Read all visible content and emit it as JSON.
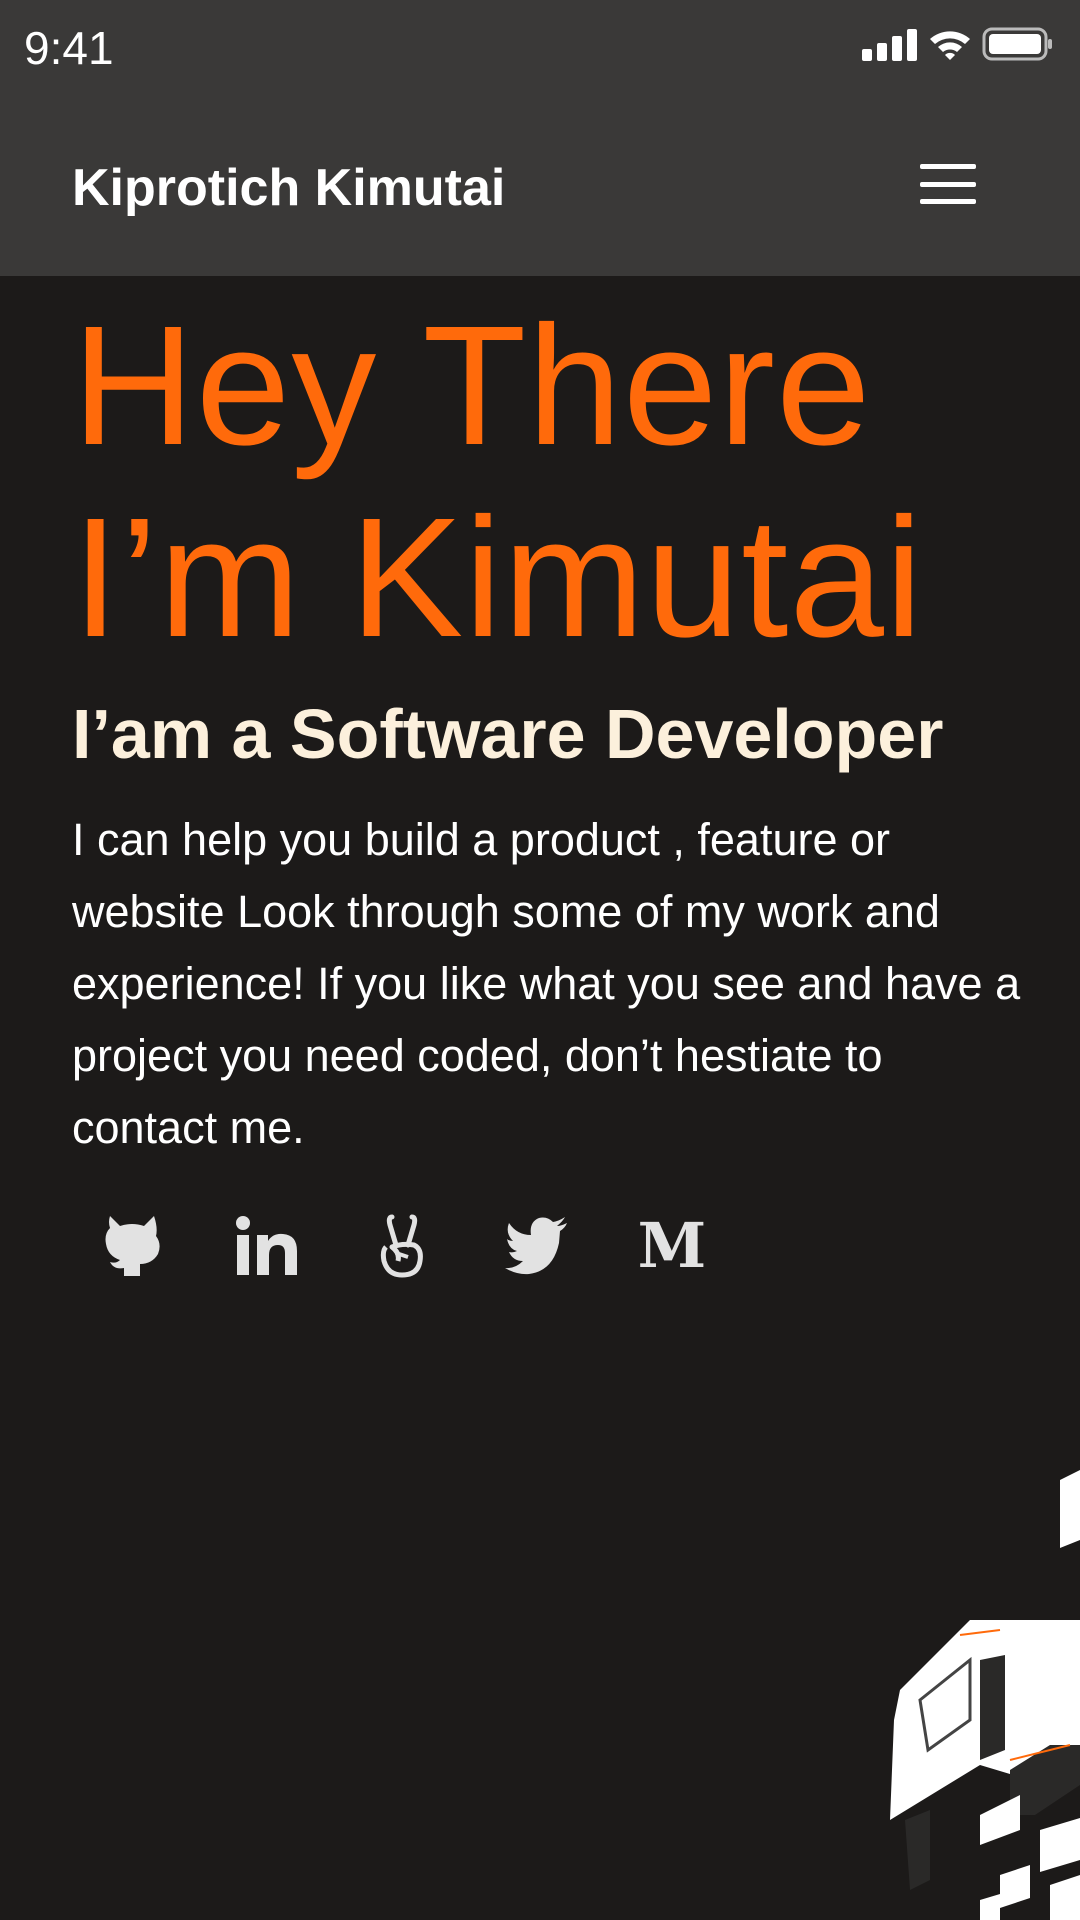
{
  "status_bar": {
    "time": "9:41"
  },
  "header": {
    "brand_name": "Kiprotich Kimutai",
    "menu_icon": "hamburger-menu-icon"
  },
  "hero": {
    "title_lines": [
      "Hey There",
      "I’m Kimutai"
    ],
    "subtitle": "I’am a Software Developer",
    "description": "I can help you build a product , feature or website Look through some of my work and experience! If you like what you see and have a project you need coded, don’t hestiate to contact me."
  },
  "social_links": [
    {
      "icon": "github-icon"
    },
    {
      "icon": "linkedin-icon"
    },
    {
      "icon": "angellist-icon"
    },
    {
      "icon": "twitter-icon"
    },
    {
      "icon": "medium-icon",
      "glyph": "M"
    }
  ],
  "colors": {
    "background": "#1c1a19",
    "header": "#3a3938",
    "accent": "#ff6a0b",
    "subtitle": "#fcf0dc",
    "icon": "#e2e2e2"
  }
}
